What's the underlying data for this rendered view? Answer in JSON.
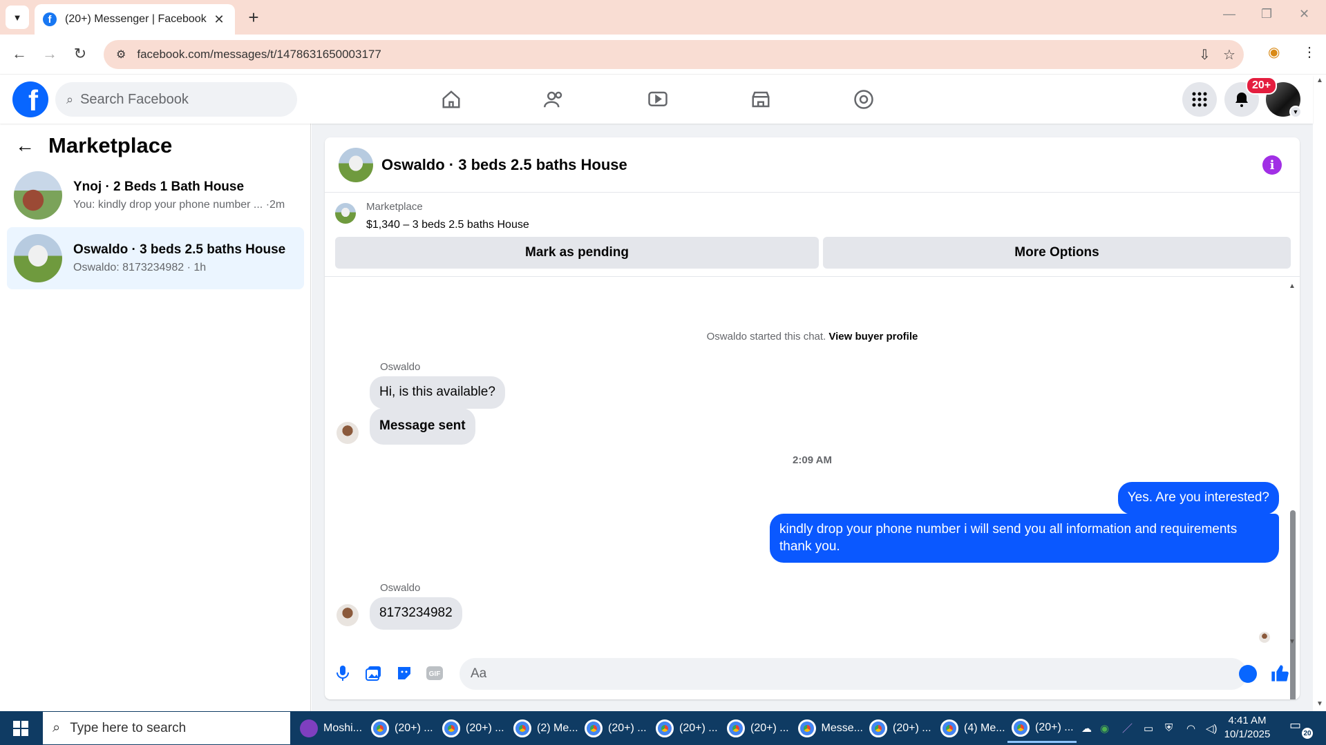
{
  "browser": {
    "tab_title": "(20+) Messenger | Facebook",
    "url": "facebook.com/messages/t/1478631650003177",
    "new_tab": "+",
    "close_tab": "✕"
  },
  "fb": {
    "search_placeholder": "Search Facebook",
    "notification_badge": "20+",
    "brand_color": "#0866ff"
  },
  "sidebar": {
    "title": "Marketplace",
    "conversations": [
      {
        "name": "Ynoj · 2 Beds 1 Bath House",
        "preview": "You: kindly drop your phone number ... ·2m",
        "active": false
      },
      {
        "name": "Oswaldo · 3 beds 2.5 baths House",
        "preview": "Oswaldo: 8173234982 · 1h",
        "active": true
      }
    ]
  },
  "chat": {
    "title": "Oswaldo · 3 beds 2.5 baths House",
    "listing_label": "Marketplace",
    "listing_price": "$1,340 – 3 beds 2.5 baths House",
    "mark_pending": "Mark as pending",
    "more_options": "More Options",
    "system_text": "Oswaldo started this chat.",
    "system_link": "View buyer profile",
    "messages": [
      {
        "sender": "Oswaldo",
        "text": "Hi, is this available?"
      },
      {
        "text": "Message sent"
      },
      {
        "timestamp": "2:09 AM"
      },
      {
        "sender": "me",
        "text": "Yes. Are you interested?"
      },
      {
        "sender": "me",
        "text": "kindly drop your phone number i will send you all information and requirements thank you."
      },
      {
        "sender": "Oswaldo",
        "text": "8173234982"
      }
    ],
    "composer_placeholder": "Aa",
    "outgoing_color": "#0a58ff"
  },
  "taskbar": {
    "search_placeholder": "Type here to search",
    "apps": [
      "Moshi...",
      "(20+) ...",
      "(20+) ...",
      "(2) Me...",
      "(20+) ...",
      "(20+) ...",
      "(20+) ...",
      "Messe...",
      "(20+) ...",
      "(4) Me...",
      "(20+) ..."
    ],
    "time": "4:41 AM",
    "date": "10/1/2025",
    "notif_count": "20"
  }
}
